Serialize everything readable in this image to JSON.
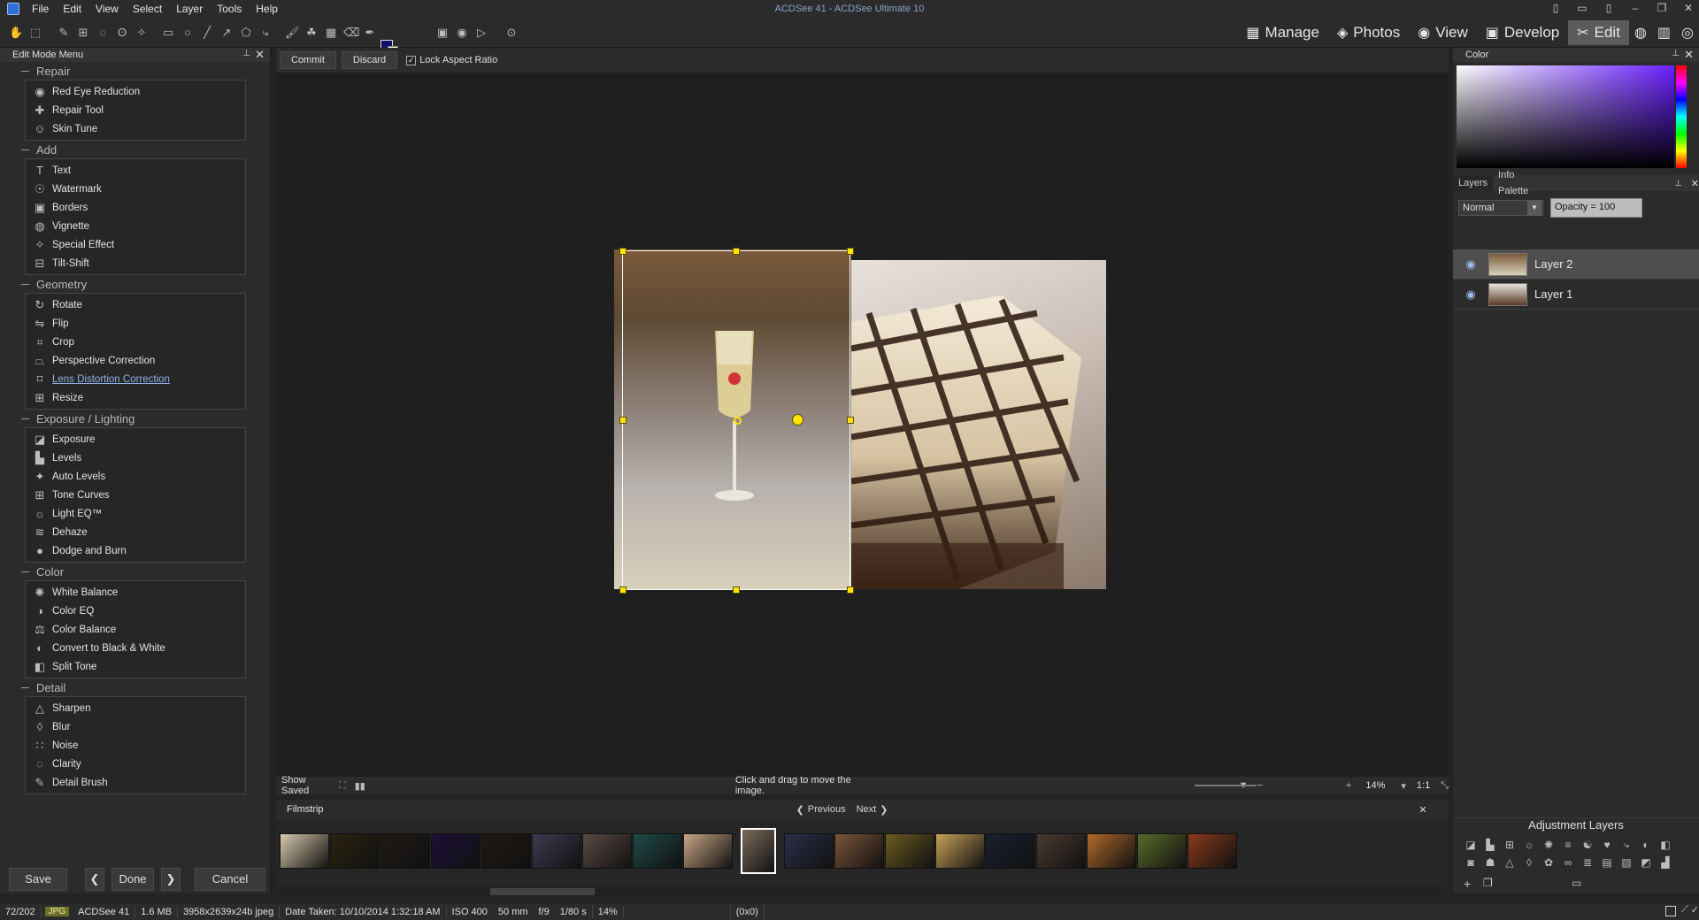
{
  "app": {
    "window_title": "ACDSee 41 - ACDSee Ultimate 10"
  },
  "menubar": {
    "items": [
      "File",
      "Edit",
      "View",
      "Select",
      "Layer",
      "Tools",
      "Help"
    ]
  },
  "modes": [
    {
      "label": "Manage",
      "icon": "grid-icon"
    },
    {
      "label": "Photos",
      "icon": "photos-icon"
    },
    {
      "label": "View",
      "icon": "eye-icon"
    },
    {
      "label": "Develop",
      "icon": "develop-icon"
    },
    {
      "label": "Edit",
      "icon": "edit-icon",
      "active": true
    }
  ],
  "left_panel": {
    "title": "Edit Mode Menu",
    "groups": [
      {
        "name": "Repair",
        "items": [
          "Red Eye Reduction",
          "Repair Tool",
          "Skin Tune"
        ]
      },
      {
        "name": "Add",
        "items": [
          "Text",
          "Watermark",
          "Borders",
          "Vignette",
          "Special Effect",
          "Tilt-Shift"
        ]
      },
      {
        "name": "Geometry",
        "items": [
          "Rotate",
          "Flip",
          "Crop",
          "Perspective Correction",
          "Lens Distortion Correction",
          "Resize"
        ]
      },
      {
        "name": "Exposure / Lighting",
        "items": [
          "Exposure",
          "Levels",
          "Auto Levels",
          "Tone Curves",
          "Light EQ™",
          "Dehaze",
          "Dodge and Burn"
        ]
      },
      {
        "name": "Color",
        "items": [
          "White Balance",
          "Color EQ",
          "Color Balance",
          "Convert to Black & White",
          "Split Tone"
        ]
      },
      {
        "name": "Detail",
        "items": [
          "Sharpen",
          "Blur",
          "Noise",
          "Clarity",
          "Detail Brush"
        ]
      }
    ],
    "buttons": {
      "save": "Save",
      "done": "Done",
      "cancel": "Cancel"
    }
  },
  "options_bar": {
    "commit": "Commit",
    "discard": "Discard",
    "lock_aspect_ratio": "Lock Aspect Ratio",
    "lock_checked": true
  },
  "canvas_status": {
    "show_saved": "Show Saved",
    "hint": "Click and drag to move the image.",
    "zoom": "14%",
    "ratio": "1:1"
  },
  "filmstrip": {
    "title": "Filmstrip",
    "previous": "Previous",
    "next": "Next",
    "thumb_colors": [
      "#d8c9ad",
      "#2a2410",
      "#1f1a16",
      "#1b1036",
      "#201812",
      "#3f3a50",
      "#5a4a44",
      "#1f4a48",
      "#c9a686",
      "#7b6a5a",
      "#2a2e4a",
      "#7a5438",
      "#6a5a20",
      "#c8a15a",
      "#1a2030",
      "#4a3a30",
      "#b06a2a",
      "#5a6a2a",
      "#8a3a1a"
    ]
  },
  "right_panel": {
    "color_title": "Color",
    "tabs": [
      "Layers",
      "Info Palette"
    ],
    "blend_mode": "Normal",
    "opacity": "Opacity = 100",
    "layers": [
      {
        "name": "Layer 2",
        "selected": true
      },
      {
        "name": "Layer 1",
        "selected": false
      }
    ],
    "adjustment_layers_title": "Adjustment Layers"
  },
  "status_bar": {
    "index": "72/202",
    "format": "JPG",
    "app": "ACDSee 41",
    "size": "1.6 MB",
    "dimensions": "3958x2639x24b jpeg",
    "date_taken": "Date Taken: 10/10/2014 1:32:18 AM",
    "iso": "ISO 400",
    "focal": "50 mm",
    "aperture": "f/9",
    "shutter": "1/80 s",
    "zoom": "14%",
    "coords": "(0x0)"
  }
}
